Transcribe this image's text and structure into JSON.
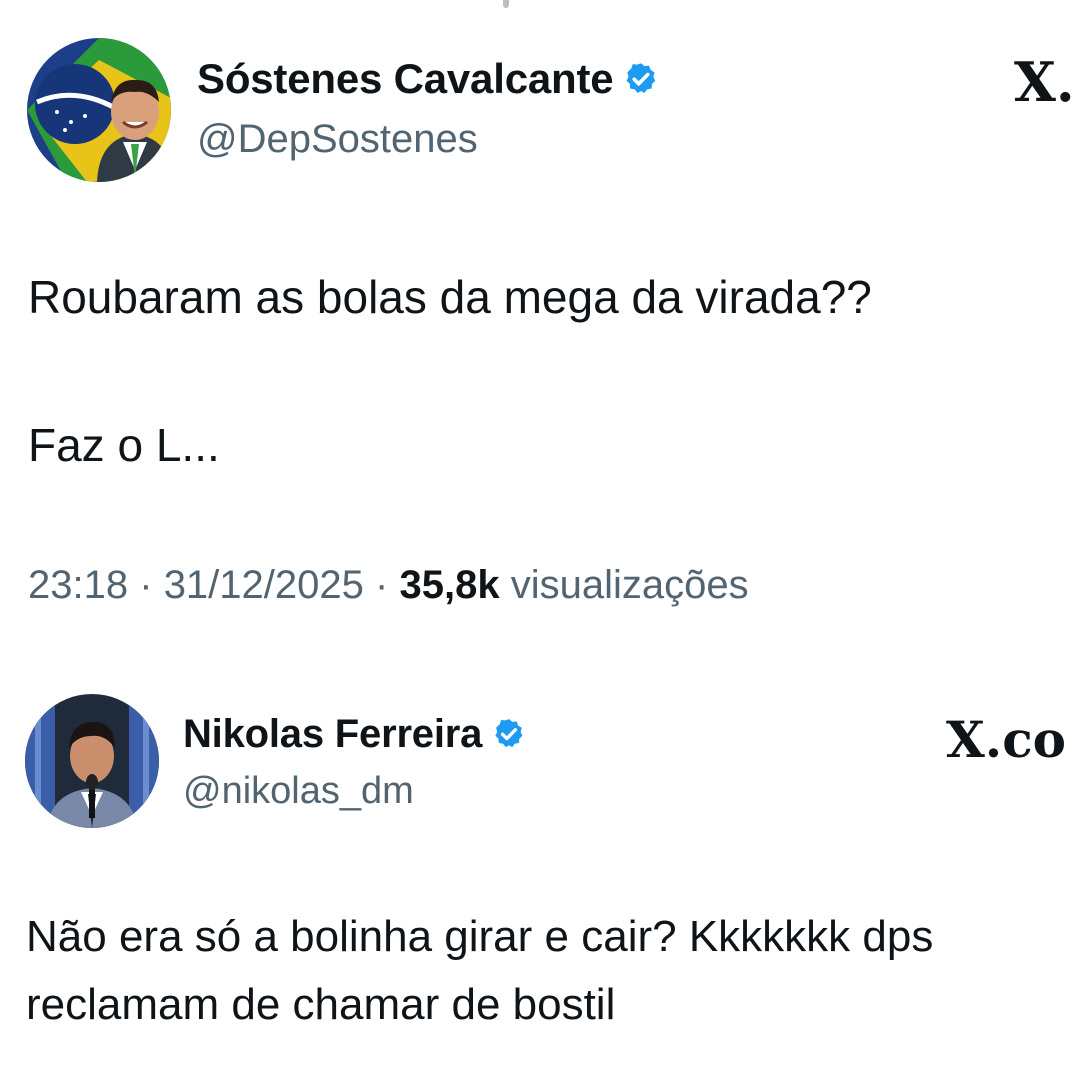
{
  "tweets": [
    {
      "author": {
        "display_name": "Sóstenes Cavalcante",
        "handle": "@DepSostenes",
        "verified": true,
        "avatar_icon": "avatar-photo"
      },
      "platform_logo": "X.",
      "text_lines": [
        "Roubaram as bolas da mega da virada??",
        "Faz o L..."
      ],
      "time": "23:18",
      "date": "31/12/2025",
      "views_count": "35,8k",
      "views_label": "visualizações",
      "separator": "·"
    },
    {
      "author": {
        "display_name": "Nikolas Ferreira",
        "handle": "@nikolas_dm",
        "verified": true,
        "avatar_icon": "avatar-photo"
      },
      "platform_logo": "X.co",
      "text_lines": [
        "Não era só a bolinha girar e cair? Kkkkkkk dps",
        "reclamam de chamar de bostil"
      ]
    }
  ],
  "colors": {
    "text": "#0f1419",
    "secondary": "#536471",
    "verified_blue": "#1d9bf0"
  }
}
